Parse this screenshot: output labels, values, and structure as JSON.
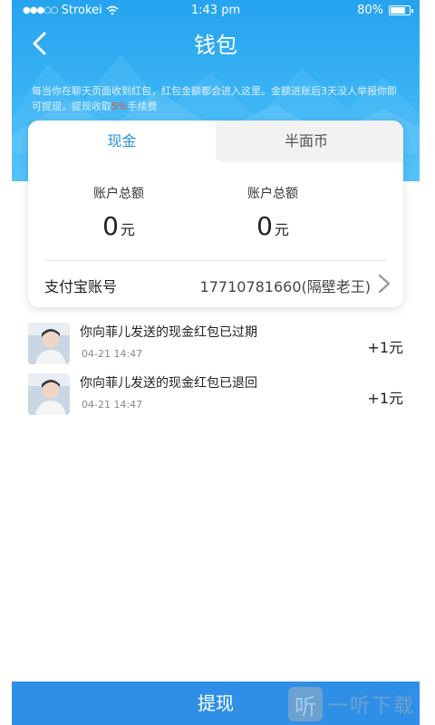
{
  "status": {
    "carrier": "Strokei",
    "time": "1:43 pm",
    "battery": "80%",
    "battery_level": 0.8
  },
  "nav": {
    "title": "钱包"
  },
  "notice": {
    "text_before": "每当你在聊天页面收到红包，红包金额都会进入这里。金额进账后3天没人举报你即可提现，提现收取",
    "highlight": "5%",
    "text_after": "手续费"
  },
  "tabs": [
    {
      "label": "现金",
      "active": true
    },
    {
      "label": "半面币",
      "active": false
    }
  ],
  "balances": [
    {
      "label": "账户总额",
      "value": "0",
      "unit": "元"
    },
    {
      "label": "账户总额",
      "value": "0",
      "unit": "元"
    }
  ],
  "alipay": {
    "label": "支付宝账号",
    "value": "17710781660(隔壁老王)"
  },
  "records": [
    {
      "title": "你向菲儿发送的现金红包已过期",
      "time": "04-21 14:47",
      "amount": "+1元"
    },
    {
      "title": "你向菲儿发送的现金红包已退回",
      "time": "04-21 14:47",
      "amount": "+1元"
    }
  ],
  "withdraw_label": "提现",
  "watermark": {
    "icon_char": "听",
    "text": "一听下载"
  },
  "colors": {
    "primary": "#2f8fe6",
    "header": "#2aa7f0",
    "highlight": "#f04d3b"
  }
}
